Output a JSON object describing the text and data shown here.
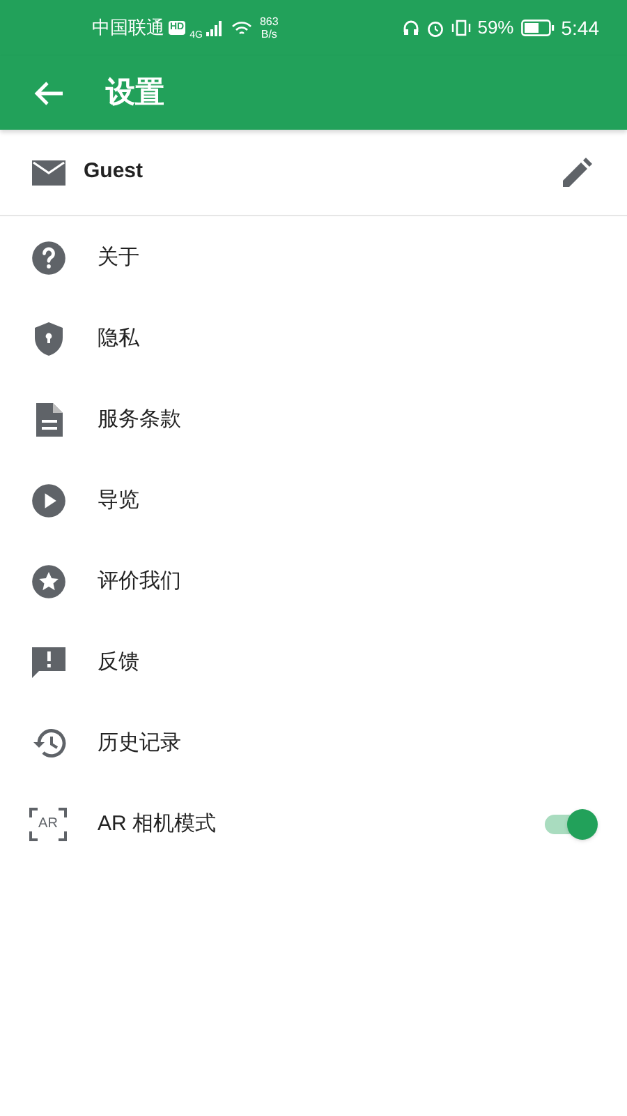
{
  "status_bar": {
    "carrier": "中国联通",
    "hd": "HD",
    "network": "4G",
    "speed": "863",
    "speed_unit": "B/s",
    "battery": "59%",
    "time": "5:44"
  },
  "app_bar": {
    "title": "设置"
  },
  "account": {
    "name": "Guest"
  },
  "items": [
    {
      "kind": "link",
      "label": "关于"
    },
    {
      "kind": "link",
      "label": "隐私"
    },
    {
      "kind": "link",
      "label": "服务条款"
    },
    {
      "kind": "link",
      "label": "导览"
    },
    {
      "kind": "link",
      "label": "评价我们"
    },
    {
      "kind": "link",
      "label": "反馈"
    },
    {
      "kind": "link",
      "label": "历史记录"
    },
    {
      "kind": "toggle",
      "label": "AR 相机模式",
      "icon_text": "AR",
      "on": true
    }
  ]
}
